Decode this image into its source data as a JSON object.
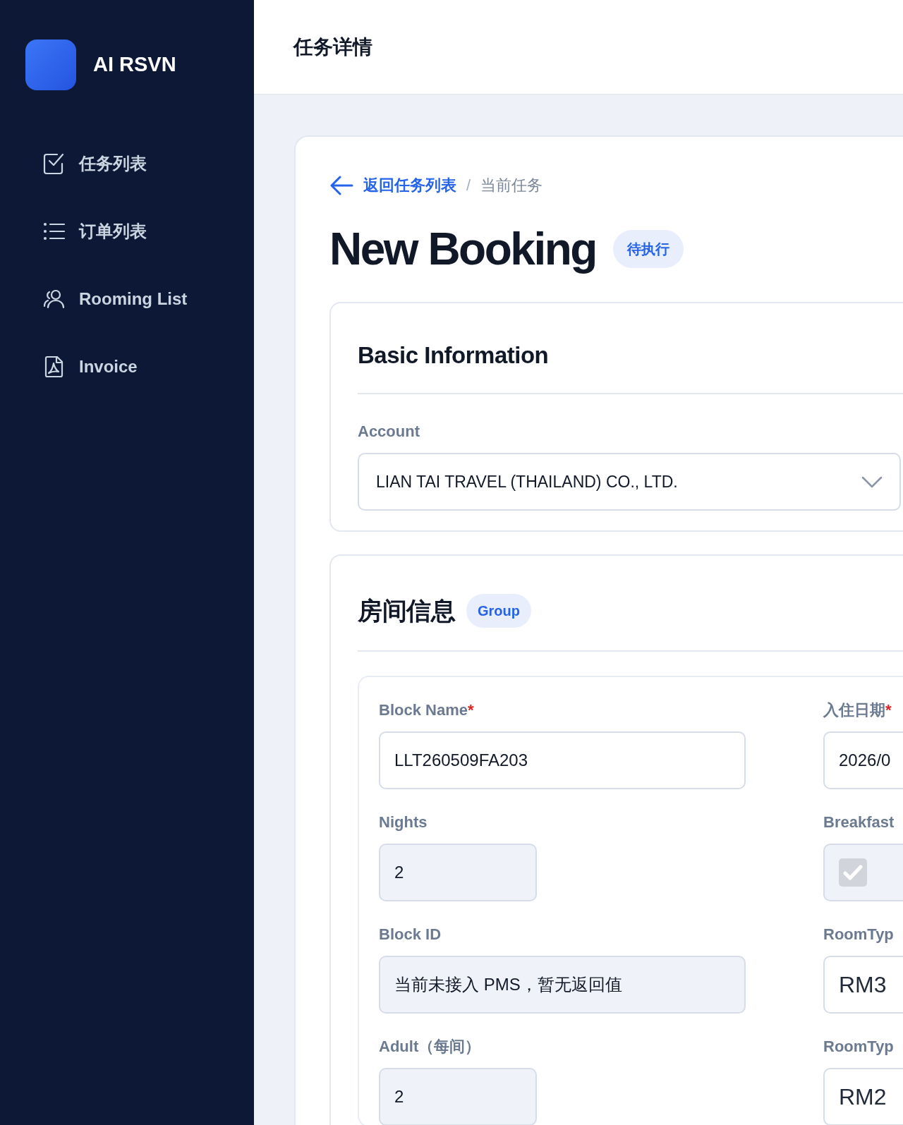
{
  "sidebar": {
    "app_name": "AI RSVN",
    "items": [
      {
        "label": "任务列表"
      },
      {
        "label": "订单列表"
      },
      {
        "label": "Rooming List"
      },
      {
        "label": "Invoice"
      }
    ]
  },
  "header": {
    "title": "任务详情"
  },
  "breadcrumb": {
    "back": "返回任务列表",
    "separator": "/",
    "current": "当前任务"
  },
  "page": {
    "title": "New Booking",
    "status": "待执行"
  },
  "basic_information": {
    "title": "Basic Information",
    "account": {
      "label": "Account",
      "value": "LIAN TAI TRAVEL (THAILAND) CO., LTD."
    }
  },
  "room_information": {
    "title": "房间信息",
    "tag": "Group",
    "fields": [
      {
        "kind": "text",
        "label": "Block Name",
        "mark": "*",
        "value": "LLT260509FA203",
        "readonly": false
      },
      {
        "kind": "text",
        "label": "入住日期",
        "mark": "*",
        "value": "2026/0",
        "readonly": false
      },
      {
        "kind": "number",
        "label": "Nights",
        "value": "2",
        "readonly": true
      },
      {
        "kind": "checkbox",
        "label": "Breakfast",
        "checked": true,
        "readonly": true
      },
      {
        "kind": "text",
        "label": "Block ID",
        "value": "当前未接入 PMS，暂无返回值",
        "readonly": true
      },
      {
        "kind": "code",
        "label": "RoomTyp",
        "value": "RM3",
        "readonly": false
      },
      {
        "kind": "number",
        "label": "Adult（每间）",
        "value": "2",
        "readonly": true
      },
      {
        "kind": "code",
        "label": "RoomTyp",
        "value": "RM2",
        "readonly": false
      }
    ]
  }
}
